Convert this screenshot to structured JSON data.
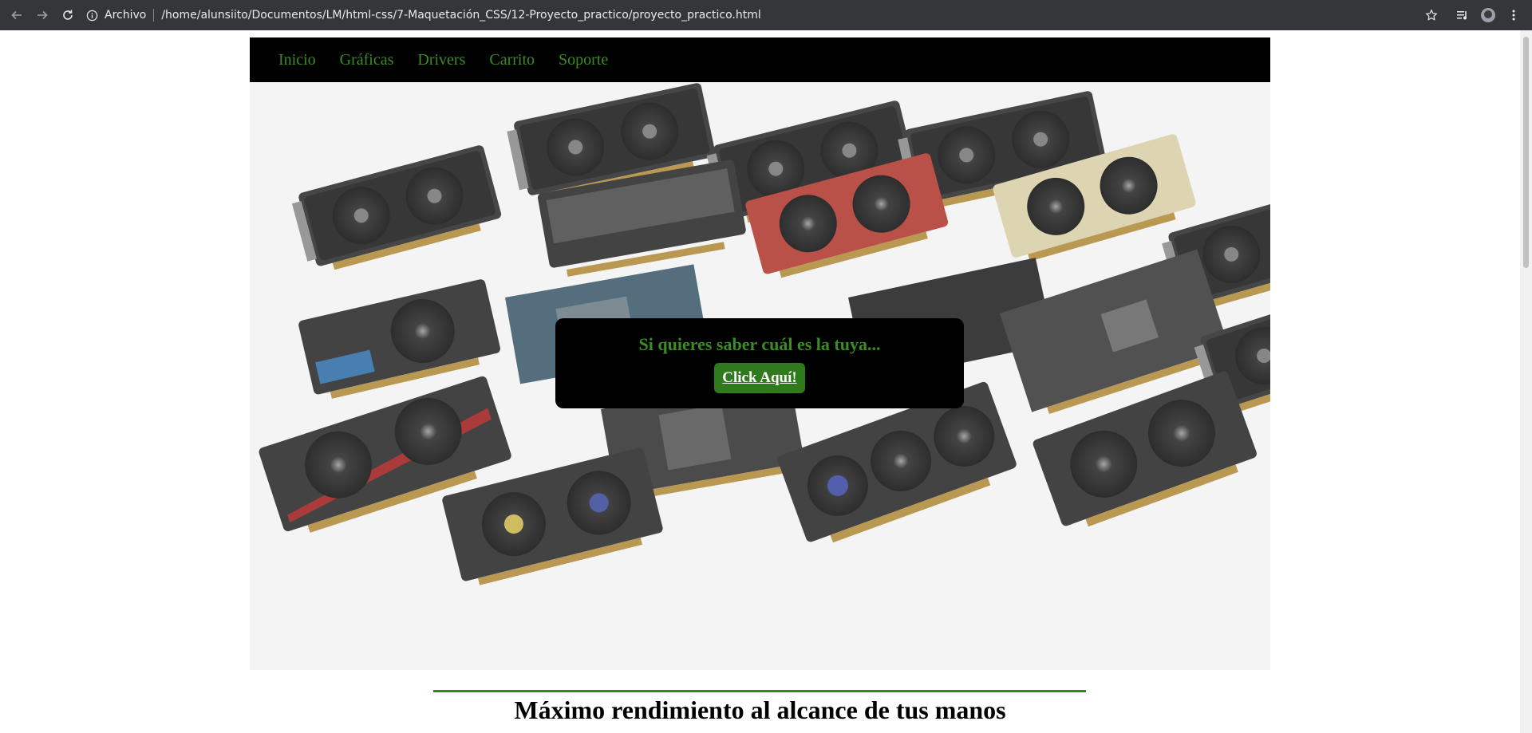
{
  "browser": {
    "scheme_label": "Archivo",
    "url": "/home/alunsiito/Documentos/LM/html-css/7-Maquetación_CSS/12-Proyecto_practico/proyecto_practico.html"
  },
  "nav": {
    "items": [
      {
        "label": "Inicio"
      },
      {
        "label": "Gráficas"
      },
      {
        "label": "Drivers"
      },
      {
        "label": "Carrito"
      },
      {
        "label": "Soporte"
      }
    ]
  },
  "hero": {
    "cta_text": "Si quieres saber cuál es la tuya...",
    "cta_button": "Click Aquí!"
  },
  "headline": "Máximo rendimiento al alcance de tus manos",
  "colors": {
    "nav_bg": "#000000",
    "nav_link": "#3b8d23",
    "cta_button_bg": "#2f7a1c",
    "divider": "#2e8b19"
  }
}
